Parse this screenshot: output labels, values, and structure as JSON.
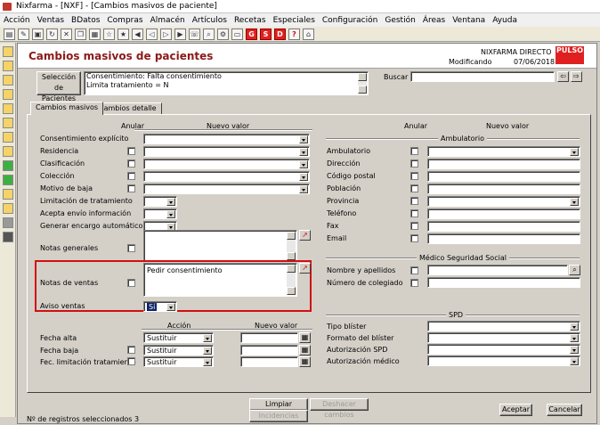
{
  "window": {
    "title": "Nixfarma - [NXF] - [Cambios masivos de paciente]"
  },
  "menu": {
    "items": [
      "Acción",
      "Ventas",
      "BDatos",
      "Compras",
      "Almacén",
      "Artículos",
      "Recetas",
      "Especiales",
      "Configuración",
      "Gestión",
      "Áreas",
      "Ventana",
      "Ayuda"
    ]
  },
  "toolbar": {
    "g": "G",
    "s": "S",
    "d": "D",
    "help": "?"
  },
  "header": {
    "title": "Cambios masivos de pacientes",
    "company": "NIXFARMA DIRECTO",
    "mode": "Modificando",
    "date": "07/06/2018",
    "logo_text": "PULSO"
  },
  "selection": {
    "button": "Selección de Pacientes",
    "criteria_line1": "Consentimiento: Falta consentimiento",
    "criteria_line2": "Limita tratamiento = N",
    "search_label": "Buscar",
    "search_value": ""
  },
  "tabs": {
    "t1": "Cambios masivos",
    "t2": "Cambios detalle"
  },
  "left": {
    "col_anular": "Anular",
    "col_nuevo": "Nuevo valor",
    "consentimiento": "Consentimiento explícito",
    "residencia": "Residencia",
    "clasificacion": "Clasificación",
    "coleccion": "Colección",
    "motivo": "Motivo de baja",
    "limitacion": "Limitación de tratamiento",
    "acepta": "Acepta envío información",
    "generar": "Generar encargo automático",
    "notas_generales": "Notas generales",
    "notas_ventas": "Notas de ventas",
    "notas_ventas_value": "Pedir consentimiento",
    "aviso": "Aviso ventas",
    "aviso_value": "Sí",
    "col_accion": "Acción",
    "col_nuevo2": "Nuevo valor",
    "fecha_alta": "Fecha alta",
    "fecha_baja": "Fecha baja",
    "fec_lim": "Fec. limitación tratamiento",
    "sustituir": "Sustituir"
  },
  "right": {
    "col_anular": "Anular",
    "col_nuevo": "Nuevo valor",
    "sec_amb": "Ambulatorio",
    "ambulatorio": "Ambulatorio",
    "direccion": "Dirección",
    "cp": "Código postal",
    "poblacion": "Población",
    "provincia": "Provincia",
    "telefono": "Teléfono",
    "fax": "Fax",
    "email": "Email",
    "sec_medico": "Médico Seguridad Social",
    "nombre": "Nombre y apellidos",
    "colegiado": "Número de colegiado",
    "sec_spd": "SPD",
    "blister": "Tipo blíster",
    "formato": "Formato del blíster",
    "autspd": "Autorización SPD",
    "autmed": "Autorización médico"
  },
  "footer": {
    "limpiar": "Limpiar",
    "deshacer": "Deshacer cambios",
    "incidencias": "Incidencias",
    "aceptar": "Aceptar",
    "cancelar": "Cancelar",
    "status": "Nº de registros seleccionados 3"
  }
}
